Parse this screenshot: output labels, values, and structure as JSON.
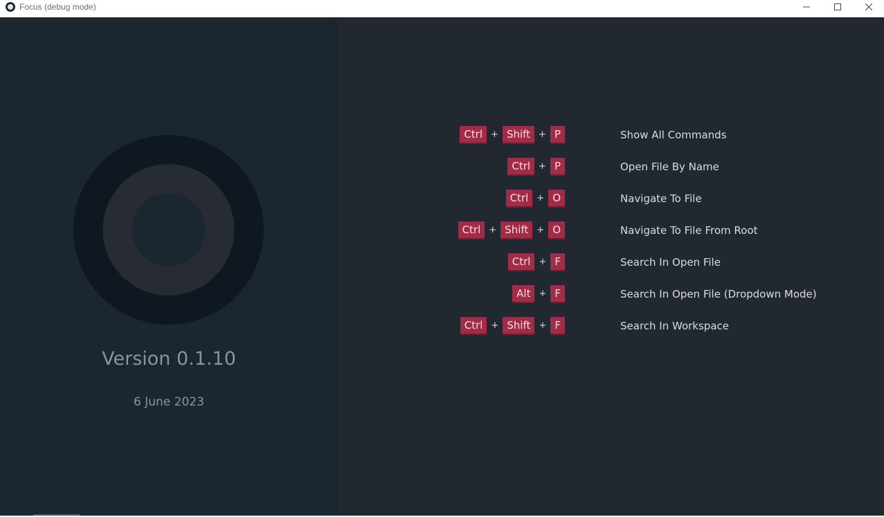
{
  "window": {
    "title": "Focus (debug mode)"
  },
  "about": {
    "version": "Version 0.1.10",
    "date": "6 June 2023"
  },
  "shortcuts": [
    {
      "keys": [
        "Ctrl",
        "Shift",
        "P"
      ],
      "label": "Show All Commands"
    },
    {
      "keys": [
        "Ctrl",
        "P"
      ],
      "label": "Open File By Name"
    },
    {
      "keys": [
        "Ctrl",
        "O"
      ],
      "label": "Navigate To File"
    },
    {
      "keys": [
        "Ctrl",
        "Shift",
        "O"
      ],
      "label": "Navigate To File From Root"
    },
    {
      "keys": [
        "Ctrl",
        "F"
      ],
      "label": "Search In Open File"
    },
    {
      "keys": [
        "Alt",
        "F"
      ],
      "label": "Search In Open File (Dropdown Mode)"
    },
    {
      "keys": [
        "Ctrl",
        "Shift",
        "F"
      ],
      "label": "Search In Workspace"
    }
  ],
  "key_separator": "+",
  "icons": {
    "app": "app-logo-icon",
    "minimize": "minimize-icon",
    "maximize": "maximize-icon",
    "close": "close-icon",
    "logo": "focus-logo-icon"
  },
  "colors": {
    "left_panel": "#1b2730",
    "right_panel": "#22282f",
    "key_badge": "#a32b48",
    "logo_outer": "#0f1820",
    "logo_ring": "#262c31",
    "logo_inner": "#1b2730"
  }
}
